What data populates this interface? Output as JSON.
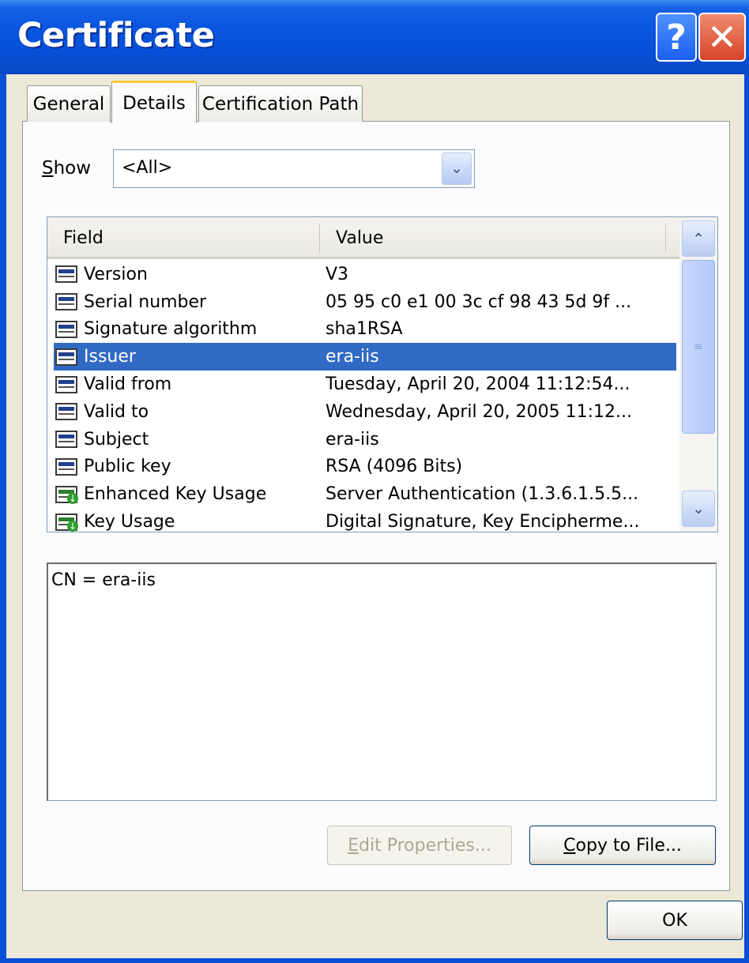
{
  "window": {
    "title": "Certificate"
  },
  "titlebar": {
    "help_glyph": "?",
    "close_glyph": "✕"
  },
  "tabs": [
    {
      "label": "General",
      "active": false
    },
    {
      "label": "Details",
      "active": true
    },
    {
      "label": "Certification Path",
      "active": false
    }
  ],
  "show": {
    "label_first": "S",
    "label_rest": "how",
    "selected": "<All>"
  },
  "list": {
    "columns": {
      "field": "Field",
      "value": "Value"
    },
    "rows": [
      {
        "field": "Version",
        "value": "V3",
        "icon": "certificate-field-icon"
      },
      {
        "field": "Serial number",
        "value": "05 95 c0 e1 00 3c cf 98 43 5d 9f ...",
        "icon": "certificate-field-icon"
      },
      {
        "field": "Signature algorithm",
        "value": "sha1RSA",
        "icon": "certificate-field-icon"
      },
      {
        "field": "Issuer",
        "value": "era-iis",
        "icon": "certificate-field-icon",
        "selected": true
      },
      {
        "field": "Valid from",
        "value": "Tuesday, April 20, 2004 11:12:54...",
        "icon": "certificate-field-icon"
      },
      {
        "field": "Valid to",
        "value": "Wednesday, April 20, 2005 11:12...",
        "icon": "certificate-field-icon"
      },
      {
        "field": "Subject",
        "value": "era-iis",
        "icon": "certificate-field-icon"
      },
      {
        "field": "Public key",
        "value": "RSA (4096 Bits)",
        "icon": "certificate-field-icon"
      },
      {
        "field": "Enhanced Key Usage",
        "value": "Server Authentication (1.3.6.1.5.5...",
        "icon": "certificate-extension-icon"
      },
      {
        "field": "Key Usage",
        "value": "Digital Signature, Key Encipherme...",
        "icon": "certificate-extension-icon"
      }
    ]
  },
  "detail": {
    "text": "CN = era-iis"
  },
  "buttons": {
    "edit_first": "E",
    "edit_rest": "dit Properties...",
    "copy_first": "C",
    "copy_rest": "opy to File...",
    "ok": "OK"
  },
  "colors": {
    "titlebar": "#0a56e0",
    "selection": "#316ac5",
    "active_tab_accent": "#ffc73c",
    "face": "#ece9d8"
  }
}
